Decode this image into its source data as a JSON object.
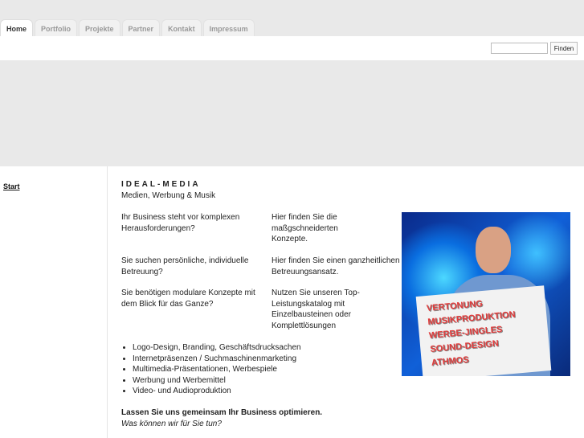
{
  "nav": {
    "tabs": [
      "Home",
      "Portfolio",
      "Projekte",
      "Partner",
      "Kontakt",
      "Impressum"
    ]
  },
  "search": {
    "value": "",
    "button": "Finden"
  },
  "sidebar": {
    "start": "Start"
  },
  "main": {
    "brand": "IDEAL-MEDIA",
    "tagline": "Medien, Werbung & Musik",
    "rows": [
      {
        "q": "Ihr Business steht vor komplexen Herausforderungen?",
        "a": "Hier finden Sie die maßgschneiderten Konzepte."
      },
      {
        "q": "Sie suchen persönliche, individuelle Betreuung?",
        "a": "Hier finden Sie einen ganzheitlichen Betreuungsansatz."
      },
      {
        "q": "Sie benötigen modulare Konzepte mit dem Blick für das Ganze?",
        "a": "Nutzen Sie unseren Top-Leistungskatalog mit Einzelbausteinen oder Komplettlösungen"
      }
    ],
    "services": [
      "Logo-Design, Branding, Geschäftsdrucksachen",
      "Internetpräsenzen / Suchmaschinenmarketing",
      "Multimedia-Präsentationen, Werbespiele",
      "Werbung und Werbemittel",
      "Video- und Audioproduktion"
    ],
    "cta": "Lassen Sie uns gemeinsam Ihr Business optimieren.",
    "question": "Was können wir für Sie tun?"
  },
  "photo": {
    "sign": [
      "VERTONUNG",
      "MUSIKPRODUKTION",
      "WERBE-JINGLES",
      "SOUND-DESIGN",
      "ATHMOS"
    ]
  }
}
